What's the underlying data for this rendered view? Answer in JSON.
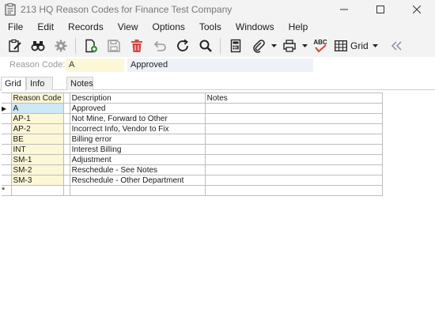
{
  "window": {
    "title": "213 HQ Reason Codes for Finance Test Company"
  },
  "menu": {
    "items": [
      "File",
      "Edit",
      "Records",
      "View",
      "Options",
      "Tools",
      "Windows",
      "Help"
    ]
  },
  "toolbar": {
    "grid_label": "Grid",
    "spell_label": "ABC"
  },
  "header": {
    "label": "Reason Code:",
    "code_value": "A",
    "description_value": "Approved"
  },
  "tabs": [
    {
      "label": "Grid",
      "active": true
    },
    {
      "label": "Info",
      "active": false
    },
    {
      "label": "Notes",
      "active": false
    }
  ],
  "grid": {
    "columns": {
      "code": "Reason Code",
      "description": "Description",
      "notes": "Notes"
    },
    "rows": [
      {
        "code": "A",
        "description": "Approved",
        "notes": ""
      },
      {
        "code": "AP-1",
        "description": "Not Mine, Forward to Other",
        "notes": ""
      },
      {
        "code": "AP-2",
        "description": "Incorrect Info, Vendor to Fix",
        "notes": ""
      },
      {
        "code": "BE",
        "description": "Billing error",
        "notes": ""
      },
      {
        "code": "INT",
        "description": "Interest Billing",
        "notes": ""
      },
      {
        "code": "SM-1",
        "description": "Adjustment",
        "notes": ""
      },
      {
        "code": "SM-2",
        "description": "Reschedule - See Notes",
        "notes": ""
      },
      {
        "code": "SM-3",
        "description": "Reschedule - Other Department",
        "notes": ""
      }
    ],
    "new_row_marker": "*",
    "current_row_marker": "▶"
  }
}
